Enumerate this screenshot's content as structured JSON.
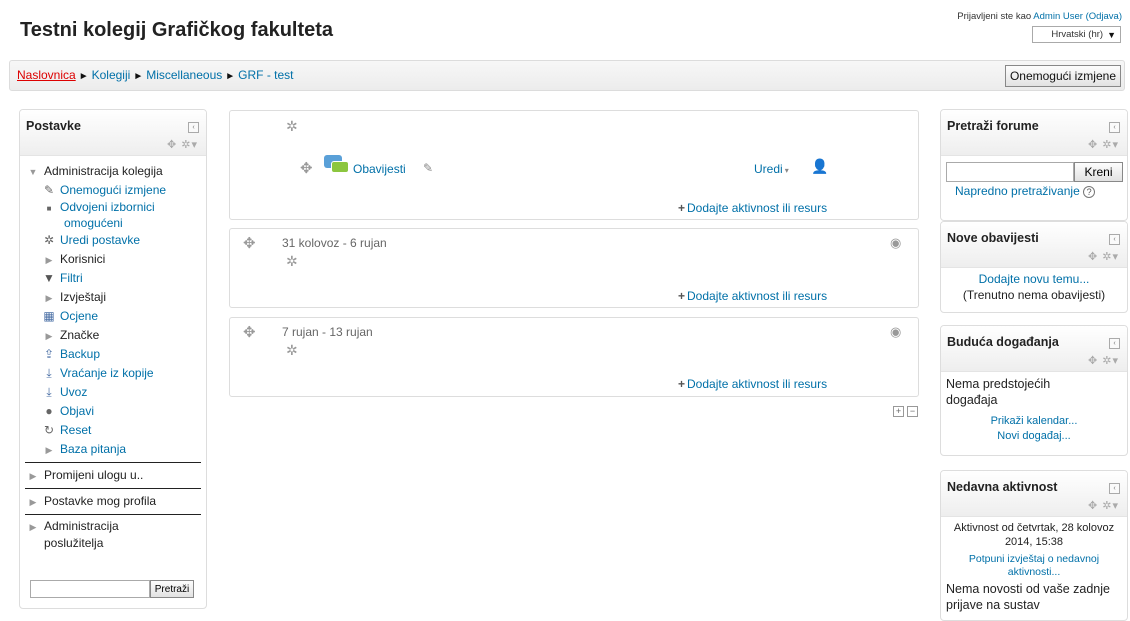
{
  "header": {
    "site_title": "Testni kolegij Grafičkog fakulteta",
    "login_prefix": "Prijavljeni ste kao",
    "user_name": "Admin User",
    "logout": "(Odjava)",
    "language": "Hrvatski (hr)"
  },
  "breadcrumb": {
    "items": [
      "Naslovnica",
      "Kolegiji",
      "Miscellaneous",
      "GRF - test"
    ],
    "separator": "►"
  },
  "editing_button": "Onemogući izmjene",
  "settings_block": {
    "title": "Postavke",
    "section_course_admin": "Administracija kolegija",
    "items": [
      {
        "label": "Onemogući izmjene",
        "icon": "pencil-icon",
        "link": true
      },
      {
        "label": "Odvojeni izbornici omogućeni",
        "icon": "bullet-icon",
        "link": true
      },
      {
        "label": "Uredi postavke",
        "icon": "gear-icon",
        "link": true
      },
      {
        "label": "Korisnici",
        "icon": "expand-arrow-icon",
        "link": false
      },
      {
        "label": "Filtri",
        "icon": "filter-icon",
        "link": true
      },
      {
        "label": "Izvještaji",
        "icon": "expand-arrow-icon",
        "link": false
      },
      {
        "label": "Ocjene",
        "icon": "grades-table-icon",
        "link": true
      },
      {
        "label": "Značke",
        "icon": "expand-arrow-icon",
        "link": false
      },
      {
        "label": "Backup",
        "icon": "upload-icon",
        "link": true
      },
      {
        "label": "Vraćanje iz kopije",
        "icon": "download-icon",
        "link": true
      },
      {
        "label": "Uvoz",
        "icon": "download-icon",
        "link": true
      },
      {
        "label": "Objavi",
        "icon": "globe-icon",
        "link": true
      },
      {
        "label": "Reset",
        "icon": "reset-icon",
        "link": true
      },
      {
        "label": "Baza pitanja",
        "icon": "expand-arrow-icon",
        "link": true
      }
    ],
    "bottom_items": [
      "Promijeni ulogu u..",
      "Postavke mog profila",
      "Administracija poslužitelja"
    ],
    "search_button": "Pretraži"
  },
  "course": {
    "general_section": {
      "forum_label": "Obavijesti",
      "edit_menu": "Uredi",
      "add_activity": "Dodajte aktivnost ili resurs"
    },
    "sections": [
      {
        "title": "31 kolovoz - 6 rujan",
        "add_activity": "Dodajte aktivnost ili resurs"
      },
      {
        "title": "7 rujan - 13 rujan",
        "add_activity": "Dodajte aktivnost ili resurs"
      }
    ]
  },
  "right_blocks": {
    "search_forums": {
      "title": "Pretraži forume",
      "go_button": "Kreni",
      "advanced": "Napredno pretraživanje"
    },
    "latest_news": {
      "title": "Nove obavijesti",
      "add_topic": "Dodajte novu temu...",
      "no_news": "(Trenutno nema obavijesti)"
    },
    "upcoming_events": {
      "title": "Buduća događanja",
      "none": "Nema predstojećih događaja",
      "calendar": "Prikaži kalendar...",
      "new_event": "Novi događaj..."
    },
    "recent_activity": {
      "title": "Nedavna aktivnost",
      "since": "Aktivnost od četvrtak, 28 kolovoz 2014, 15:38",
      "full_report": "Potpuni izvještaj o nedavnoj aktivnosti...",
      "no_news": "Nema novosti od vaše zadnje prijave na sustav"
    }
  }
}
